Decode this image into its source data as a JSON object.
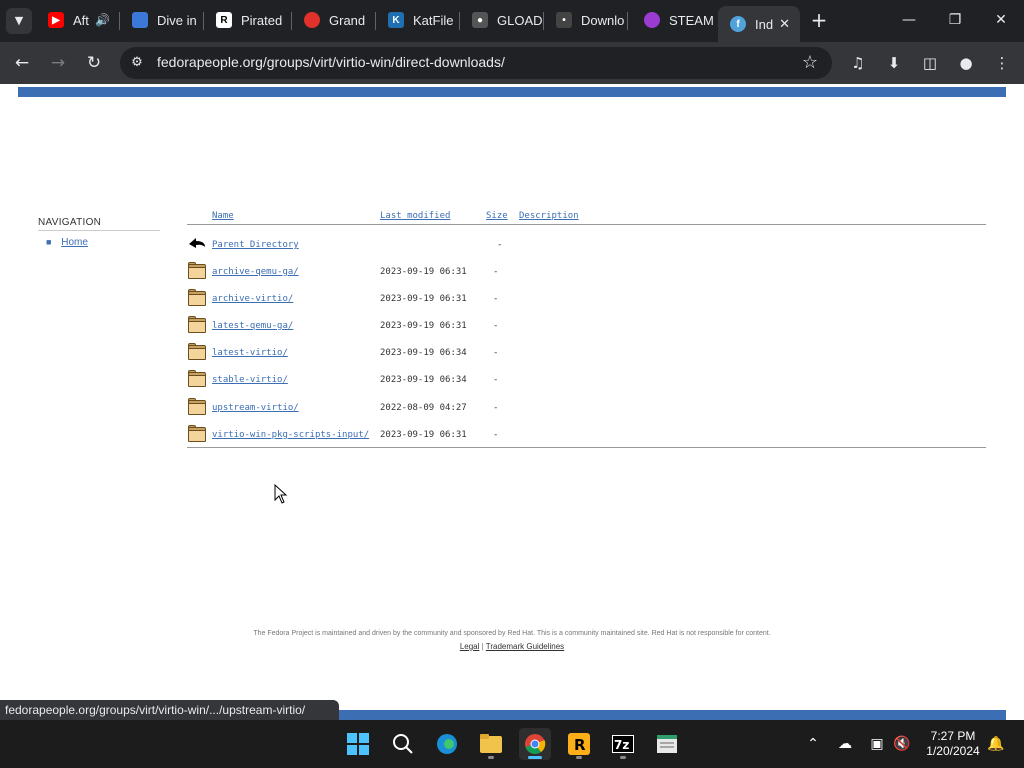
{
  "browser": {
    "tabs": [
      {
        "label": "Aft",
        "favicon": "youtube-icon",
        "color": "#ff0000"
      },
      {
        "label": "Dive in",
        "favicon": "dive-icon",
        "color": "#3c78d8"
      },
      {
        "label": "Pirated",
        "favicon": "r-icon",
        "color": "#ffffff"
      },
      {
        "label": "Grand",
        "favicon": "mario-icon",
        "color": "#e0312a"
      },
      {
        "label": "KatFile",
        "favicon": "k-icon",
        "color": "#1f6fb2"
      },
      {
        "label": "GLOAD",
        "favicon": "gamepad-icon",
        "color": "#cccccc"
      },
      {
        "label": "Downlo",
        "favicon": "download-site-icon",
        "color": "#cccccc"
      },
      {
        "label": "STEAM",
        "favicon": "steam-icon",
        "color": "#9b3bd1"
      },
      {
        "label": "Ind",
        "favicon": "fedora-icon",
        "color": "#51a2da"
      }
    ],
    "url": "fedorapeople.org/groups/virt/virtio-win/direct-downloads/",
    "status_url": "fedorapeople.org/groups/virt/virtio-win/.../upstream-virtio/"
  },
  "page": {
    "nav_heading": "NAVIGATION",
    "nav_home": "Home",
    "listing": {
      "headers": {
        "name": "Name",
        "last_modified": "Last modified",
        "size": "Size",
        "description": "Description"
      },
      "parent": {
        "name": "Parent Directory",
        "size": "-"
      },
      "rows": [
        {
          "name": "archive-qemu-ga/",
          "date": "2023-09-19 06:31",
          "size": "-"
        },
        {
          "name": "archive-virtio/",
          "date": "2023-09-19 06:31",
          "size": "-"
        },
        {
          "name": "latest-qemu-ga/",
          "date": "2023-09-19 06:31",
          "size": "-"
        },
        {
          "name": "latest-virtio/",
          "date": "2023-09-19 06:34",
          "size": "-"
        },
        {
          "name": "stable-virtio/",
          "date": "2023-09-19 06:34",
          "size": "-"
        },
        {
          "name": "upstream-virtio/",
          "date": "2022-08-09 04:27",
          "size": "-"
        },
        {
          "name": "virtio-win-pkg-scripts-input/",
          "date": "2023-09-19 06:31",
          "size": "-"
        }
      ]
    },
    "footer": {
      "text": "The Fedora Project is maintained and driven by the community and sponsored by Red Hat. This is a community maintained site. Red Hat is not responsible for content.",
      "legal": "Legal",
      "separator": "|",
      "trademark": "Trademark Guidelines"
    }
  },
  "taskbar": {
    "apps": [
      "start-icon",
      "search-icon",
      "edge-icon",
      "file-explorer-icon",
      "chrome-icon",
      "rockstar-icon",
      "7zip-icon",
      "notepad-icon"
    ],
    "time": "7:27 PM",
    "date": "1/20/2024"
  },
  "colors": {
    "link": "#3c6eb4",
    "fedora_blue": "#3c6eb4"
  }
}
